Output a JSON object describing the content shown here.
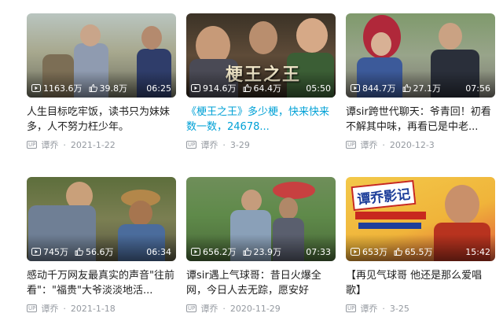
{
  "videos": [
    {
      "views": "1163.6万",
      "likes": "39.8万",
      "duration": "06:25",
      "title": "人生目标吃牢饭，读书只为妹妹多，人不努力枉少年。",
      "uploader": "谭乔",
      "date": "2021-1-22",
      "thumb_text": ""
    },
    {
      "views": "914.6万",
      "likes": "64.4万",
      "duration": "05:50",
      "title": "《梗王之王》多少梗，快来快来数一数，24678...",
      "uploader": "谭乔",
      "date": "3-29",
      "thumb_text": "梗王之王"
    },
    {
      "views": "844.7万",
      "likes": "27.1万",
      "duration": "07:56",
      "title": "谭sir跨世代聊天：爷青回！初看不解其中味，再看已是中老...",
      "uploader": "谭乔",
      "date": "2020-12-3",
      "thumb_text": ""
    },
    {
      "views": "745万",
      "likes": "56.6万",
      "duration": "06:34",
      "title": "感动千万网友最真实的声音\"往前看\"：\"福贵\"大爷淡淡地活...",
      "uploader": "谭乔",
      "date": "2021-1-18",
      "thumb_text": ""
    },
    {
      "views": "656.2万",
      "likes": "23.9万",
      "duration": "07:33",
      "title": "谭sir遇上气球哥：昔日火爆全网，今日人去无踪，愿安好",
      "uploader": "谭乔",
      "date": "2020-11-29",
      "thumb_text": ""
    },
    {
      "views": "653万",
      "likes": "65.5万",
      "duration": "15:42",
      "title": "【再见气球哥 他还是那么爱唱歌】",
      "uploader": "谭乔",
      "date": "3-25",
      "thumb_text": "谭乔影记"
    }
  ],
  "badge_label": "UP",
  "separator": "·",
  "colors": {
    "highlight": "#00a1d6",
    "meta": "#9499a0"
  }
}
